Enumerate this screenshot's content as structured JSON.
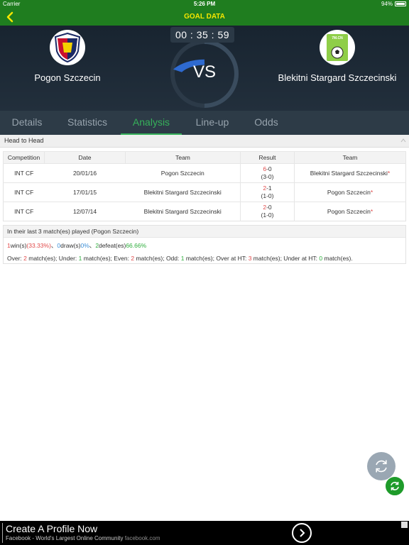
{
  "status_bar": {
    "carrier": "Carrier",
    "time": "5:26 PM",
    "battery": "94%"
  },
  "nav": {
    "title": "GOAL DATA"
  },
  "match": {
    "timer": "00 : 35 : 59",
    "vs": "VS",
    "home_team": "Pogon Szczecin",
    "away_team": "Blekitni Stargard Szczecinski",
    "away_logo_text": "7M.CN"
  },
  "tabs": [
    {
      "label": "Details"
    },
    {
      "label": "Statistics"
    },
    {
      "label": "Analysis"
    },
    {
      "label": "Line-up"
    },
    {
      "label": "Odds"
    }
  ],
  "head_to_head": {
    "title": "Head to Head",
    "columns": [
      "Competition",
      "Date",
      "Team",
      "Result",
      "Team"
    ],
    "rows": [
      {
        "competition": "INT CF",
        "date": "20/01/16",
        "team1": "Pogon Szczecin",
        "score_left": "6",
        "score_sep": "-",
        "score_right": "0",
        "half": "(3-0)",
        "team2": "Blekitni Stargard Szczecinski",
        "star": "*"
      },
      {
        "competition": "INT CF",
        "date": "17/01/15",
        "team1": "Blekitni Stargard Szczecinski",
        "score_left": "2",
        "score_sep": "-",
        "score_right": "1",
        "half": "(1-0)",
        "team2": "Pogon Szczecin",
        "star": "*"
      },
      {
        "competition": "INT CF",
        "date": "12/07/14",
        "team1": "Blekitni Stargard Szczecinski",
        "score_left": "2",
        "score_sep": "-",
        "score_right": "0",
        "half": "(1-0)",
        "team2": "Pogon Szczecin",
        "star": "*"
      }
    ]
  },
  "last_matches": {
    "title": "In their last 3 match(es) played (Pogon Szczecin)",
    "win_count": "1",
    "win_label": "win(s)",
    "win_pct": "(33.33%)",
    "sep1": "、",
    "draw_count": "0",
    "draw_label": "draw(s)",
    "draw_pct": "0%",
    "sep2": "、",
    "defeat_count": "2",
    "defeat_label": "defeat(es)",
    "defeat_pct": "66.66%",
    "over_label": "Over: ",
    "over_count": "2",
    "under_label": " match(es); Under: ",
    "under_count": "1",
    "even_label": " match(es); Even: ",
    "even_count": "2",
    "odd_label": " match(es); Odd: ",
    "odd_count": "1",
    "over_ht_label": " match(es); Over at HT: ",
    "over_ht_count": "3",
    "under_ht_label": " match(es); Under at HT: ",
    "under_ht_count": "0",
    "tail": " match(es)."
  },
  "ad": {
    "headline": "Create A Profile Now",
    "subtext": "Facebook - World's Largest Online Community",
    "domain": "facebook.com"
  },
  "colors": {
    "header_green": "#1f7d1f",
    "title_yellow": "#f5e600",
    "tab_active": "#36b15a",
    "loss_red": "#e14a4a",
    "draw_blue": "#3b8fd8",
    "win_green": "#2fae3d"
  }
}
